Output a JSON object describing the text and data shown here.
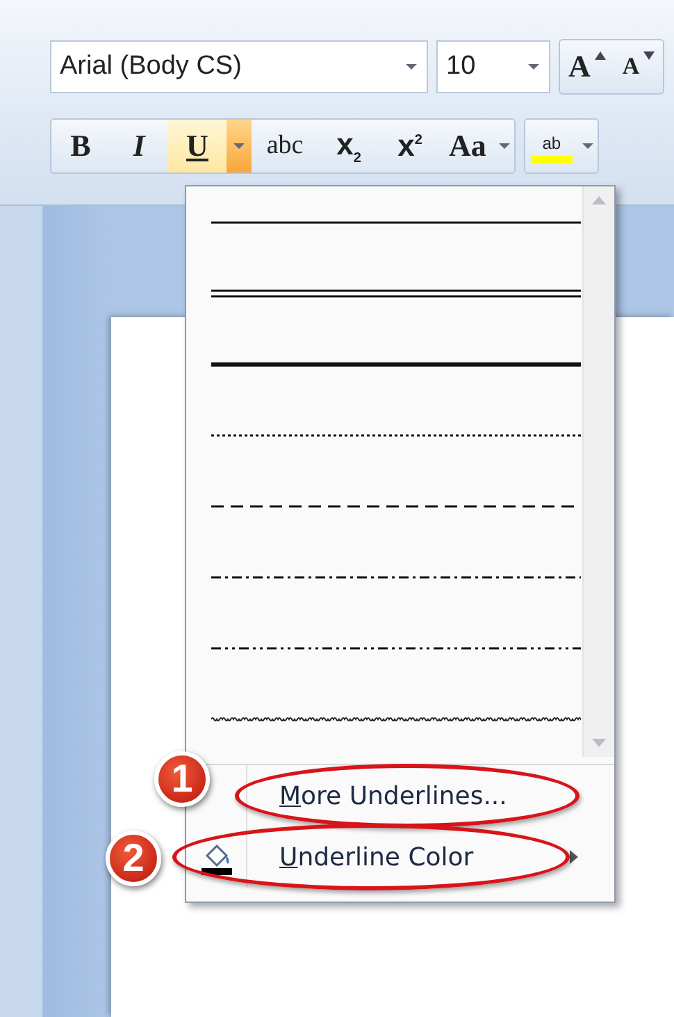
{
  "font_toolbar": {
    "font_name": "Arial (Body CS)",
    "font_size": "10",
    "size_buttons": [
      {
        "label": "A",
        "kind": "grow"
      },
      {
        "label": "A",
        "kind": "shrink"
      }
    ],
    "format_buttons": [
      {
        "label": "B",
        "kind": "bold",
        "selected": false
      },
      {
        "label": "I",
        "kind": "italic",
        "selected": false
      },
      {
        "label": "U",
        "kind": "underline",
        "selected": true,
        "dropdown_open": true
      },
      {
        "label": "abc",
        "kind": "strikethrough",
        "selected": false
      },
      {
        "label": "x$_{2}$",
        "kind": "subscript",
        "selected": false
      },
      {
        "label": "x$^{2}$",
        "kind": "superscript",
        "selected": false
      },
      {
        "label": "Aa",
        "kind": "case",
        "selected": false
      },
      {
        "label": "ab",
        "kind": "highlight",
        "selected": false
      }
    ]
  },
  "underline_menu": {
    "styles": [
      {
        "kind": "single"
      },
      {
        "kind": "double"
      },
      {
        "kind": "thick"
      },
      {
        "kind": "dotted"
      },
      {
        "kind": "dashed"
      },
      {
        "kind": "dash-dot"
      },
      {
        "kind": "dash-dot-dot"
      },
      {
        "kind": "wavy"
      }
    ],
    "commands": [
      {
        "label": "More Underlines...",
        "kind": "dialog",
        "access_key_underlined": true,
        "circled": true,
        "badge": "1"
      },
      {
        "label": "Underline Color",
        "kind": "submenu",
        "access_key_underlined": true,
        "circled": true,
        "badge": "2"
      }
    ]
  }
}
